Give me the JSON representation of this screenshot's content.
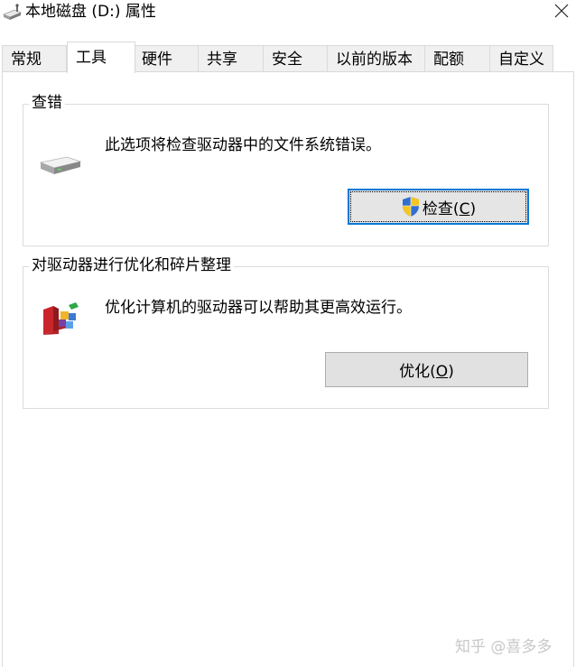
{
  "window": {
    "title": "本地磁盘 (D:) 属性",
    "close_label": "×"
  },
  "tabs": [
    {
      "label": "常规"
    },
    {
      "label": "工具",
      "active": true
    },
    {
      "label": "硬件"
    },
    {
      "label": "共享"
    },
    {
      "label": "安全"
    },
    {
      "label": "以前的版本"
    },
    {
      "label": "配额"
    },
    {
      "label": "自定义"
    }
  ],
  "error_checking": {
    "group_label": "查错",
    "description": "此选项将检查驱动器中的文件系统错误。",
    "button_prefix": "检查(",
    "button_accel": "C",
    "button_suffix": ")",
    "icon": "drive-icon",
    "button_icon": "uac-shield-icon"
  },
  "optimize": {
    "group_label": "对驱动器进行优化和碎片整理",
    "description": "优化计算机的驱动器可以帮助其更高效运行。",
    "button_prefix": "优化(",
    "button_accel": "O",
    "button_suffix": ")",
    "icon": "defrag-icon"
  },
  "watermark": "知乎 @喜多多",
  "colors": {
    "focus_border": "#0078d7",
    "button_bg": "#e1e1e1",
    "tab_bg": "#f0f0f0"
  }
}
